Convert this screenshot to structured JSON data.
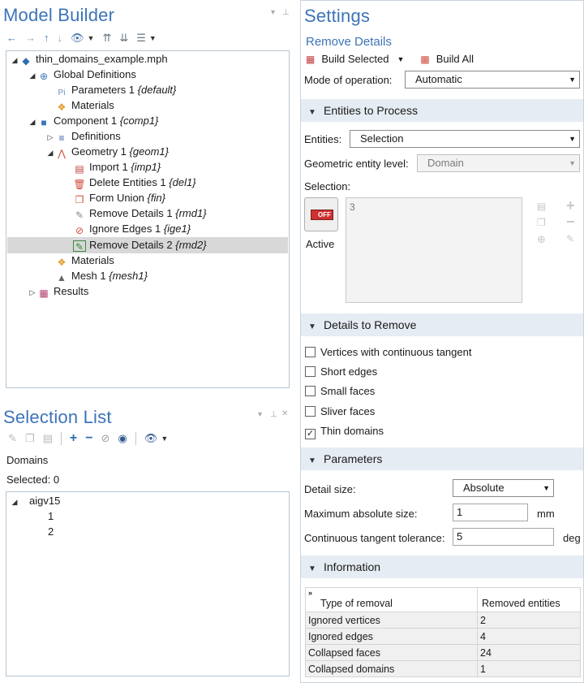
{
  "model_builder": {
    "title": "Model Builder",
    "tree": [
      {
        "label": "thin_domains_example.mph",
        "tag": "",
        "icon": "model-icon"
      },
      {
        "label": "Global Definitions",
        "tag": "",
        "icon": "globe-icon"
      },
      {
        "label": "Parameters 1",
        "tag": "{default}",
        "icon": "parameters-icon"
      },
      {
        "label": "Materials",
        "tag": "",
        "icon": "materials-icon"
      },
      {
        "label": "Component 1",
        "tag": "{comp1}",
        "icon": "component-icon"
      },
      {
        "label": "Definitions",
        "tag": "",
        "icon": "definitions-icon"
      },
      {
        "label": "Geometry 1",
        "tag": "{geom1}",
        "icon": "geometry-icon"
      },
      {
        "label": "Import 1",
        "tag": "{imp1}",
        "icon": "import-icon"
      },
      {
        "label": "Delete Entities 1",
        "tag": "{del1}",
        "icon": "delete-icon"
      },
      {
        "label": "Form Union",
        "tag": "{fin}",
        "icon": "form-union-icon"
      },
      {
        "label": "Remove Details 1",
        "tag": "{rmd1}",
        "icon": "remove-details-icon"
      },
      {
        "label": "Ignore Edges 1",
        "tag": "{ige1}",
        "icon": "ignore-edges-icon"
      },
      {
        "label": "Remove Details 2",
        "tag": "{rmd2}",
        "icon": "remove-details-icon"
      },
      {
        "label": "Materials",
        "tag": "",
        "icon": "materials-icon"
      },
      {
        "label": "Mesh 1",
        "tag": "{mesh1}",
        "icon": "mesh-icon"
      },
      {
        "label": "Results",
        "tag": "",
        "icon": "results-icon"
      }
    ]
  },
  "selection_list": {
    "title": "Selection List",
    "type_label": "Domains",
    "selected_label": "Selected: 0",
    "tree": {
      "root": "aigv15",
      "items": [
        "1",
        "2"
      ]
    }
  },
  "settings": {
    "title": "Settings",
    "subtitle": "Remove Details",
    "build_selected": "Build Selected",
    "build_all": "Build All",
    "mode_label": "Mode of operation:",
    "mode_value": "Automatic",
    "entities_section": "Entities to Process",
    "entities_label": "Entities:",
    "entities_value": "Selection",
    "geo_level_label": "Geometric entity level:",
    "geo_level_value": "Domain",
    "selection_label": "Selection:",
    "selection_value": "3",
    "toggle_text": "OFF",
    "active_label": "Active",
    "details_section": "Details to Remove",
    "checkboxes": [
      {
        "label": "Vertices with continuous tangent",
        "checked": false
      },
      {
        "label": "Short edges",
        "checked": false
      },
      {
        "label": "Small faces",
        "checked": false
      },
      {
        "label": "Sliver faces",
        "checked": false
      },
      {
        "label": "Thin domains",
        "checked": true
      }
    ],
    "params_section": "Parameters",
    "detail_size_label": "Detail size:",
    "detail_size_value": "Absolute",
    "max_abs_label": "Maximum absolute size:",
    "max_abs_value": "1",
    "max_abs_unit": "mm",
    "tangent_tol_label": "Continuous tangent tolerance:",
    "tangent_tol_value": "5",
    "tangent_tol_unit": "deg",
    "info_section": "Information",
    "info_table": {
      "headers": [
        "Type of removal",
        "Removed entities"
      ],
      "rows": [
        [
          "Ignored vertices",
          "2"
        ],
        [
          "Ignored edges",
          "4"
        ],
        [
          "Collapsed faces",
          "24"
        ],
        [
          "Collapsed domains",
          "1"
        ]
      ]
    }
  }
}
